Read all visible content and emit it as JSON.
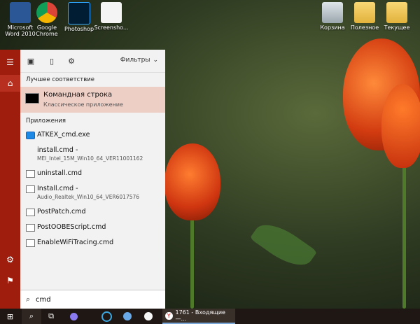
{
  "desktop": {
    "icons": [
      {
        "label_line1": "Microsoft",
        "label_line2": "Word 2010"
      },
      {
        "label_line1": "Google",
        "label_line2": "Chrome"
      },
      {
        "label_line1": "Photoshop",
        "label_line2": ""
      },
      {
        "label_line1": "Screensho...",
        "label_line2": ""
      },
      {
        "label_line1": "Корзина",
        "label_line2": ""
      },
      {
        "label_line1": "Полезное",
        "label_line2": ""
      },
      {
        "label_line1": "Текущее",
        "label_line2": ""
      }
    ]
  },
  "start_menu": {
    "filters_label": "Фильтры",
    "best_match_heading": "Лучшее соответствие",
    "best_match": {
      "title": "Командная строка",
      "subtitle": "Классическое приложение"
    },
    "apps_heading": "Приложения",
    "apps": [
      {
        "name": "ATKEX_cmd.exe",
        "sub": ""
      },
      {
        "name": "install.cmd -",
        "sub": "MEI_Intel_15M_Win10_64_VER11001162"
      },
      {
        "name": "uninstall.cmd",
        "sub": ""
      },
      {
        "name": "Install.cmd -",
        "sub": "Audio_Realtek_Win10_64_VER6017576"
      },
      {
        "name": "PostPatch.cmd",
        "sub": ""
      },
      {
        "name": "PostOOBEScript.cmd",
        "sub": ""
      },
      {
        "name": "EnableWiFiTracing.cmd",
        "sub": ""
      }
    ],
    "search_value": "cmd"
  },
  "taskbar": {
    "active_task_label": "1761 - Входящие —..."
  },
  "colors": {
    "accent": "#9e1d0d",
    "best_match_bg": "#eecfc6",
    "taskbar": "#1f1713"
  }
}
